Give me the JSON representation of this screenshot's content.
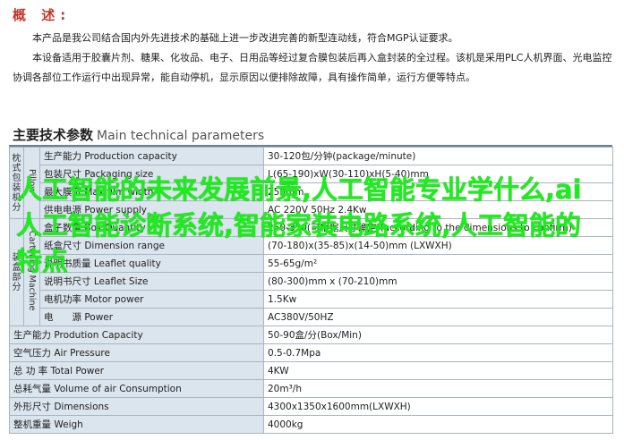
{
  "overview": {
    "title": "概 述:",
    "p1": "本产品是我公司结合国内外先进技术的基础上进一步改进完善的新型连动线，符合MGP认证要求。",
    "p2": "本设备适用于胶囊片剂、糖果、化妆品、电子、日用品等经过复合膜包装后再入盒封装的全过程。该机是采用PLC人机界面、光电监控协调各部位工作运行中出现异常，能自动停机，显示原因以便排除故障，具有操作简单，运行方便等特点。"
  },
  "spec": {
    "title_zh": "主要技术参数",
    "title_en": "Main technical parameters",
    "group1": {
      "zh": "枕式包装机分",
      "en": "Pillow"
    },
    "group2": {
      "zh": "装盒部分",
      "en": "Cartoning Machine"
    },
    "rows": [
      {
        "label": "生产能力 Production capacity",
        "value": "30-120包/分钟(package/minute)"
      },
      {
        "label": "包装尺寸 Packaging size",
        "value": "L(65-190)xW(30-110)xH(5-40)mm"
      },
      {
        "label": "最大膜宽 Max film width",
        "value": "250mm"
      },
      {
        "label": "供电电源 Power supply",
        "value": "AC 220V 50Hz 2.4Kw"
      },
      {
        "label": "盒子数量 Box Quantity",
        "value": "250-350(可根据尺寸确定)(according to the dimensions to confirm)"
      },
      {
        "label": "纸盒尺寸 Dimension range",
        "value": "(70-180)x(35-85)x(14-50)mm (LXWXH)"
      },
      {
        "label": "说明书质量 Leaflet quality",
        "value": "55-65g/m²"
      },
      {
        "label": "说明书尺寸 Leaflet Size",
        "value": "(80-300)mm x (70-210)mm"
      },
      {
        "label": "电机功率 Motor power",
        "value": "1.5Kw"
      },
      {
        "label": "电　　源 Power",
        "value": "AC380V/50HZ"
      },
      {
        "label": "生产能力 Prodution Capacity",
        "value": "50-90盒/分(Box/Min)"
      },
      {
        "label": "空气压力 Air Pressure",
        "value": "0.5-0.7Mpa"
      },
      {
        "label": "总 功 率 Total Power",
        "value": "4KW"
      },
      {
        "label": "总耗气量 Volume of air Consumption",
        "value": "20m³/h"
      },
      {
        "label": "外形尺寸 Dimensions",
        "value": "4300x1350x1600mm(LXWXH)"
      },
      {
        "label": "整机重量 Weigh",
        "value": "4000kg"
      }
    ]
  },
  "overlay_text": "人工智能的未来发展前景,人工智能专业学什么,ai人工智能诊断系统,智能家装电路系统,人工智能的特点"
}
